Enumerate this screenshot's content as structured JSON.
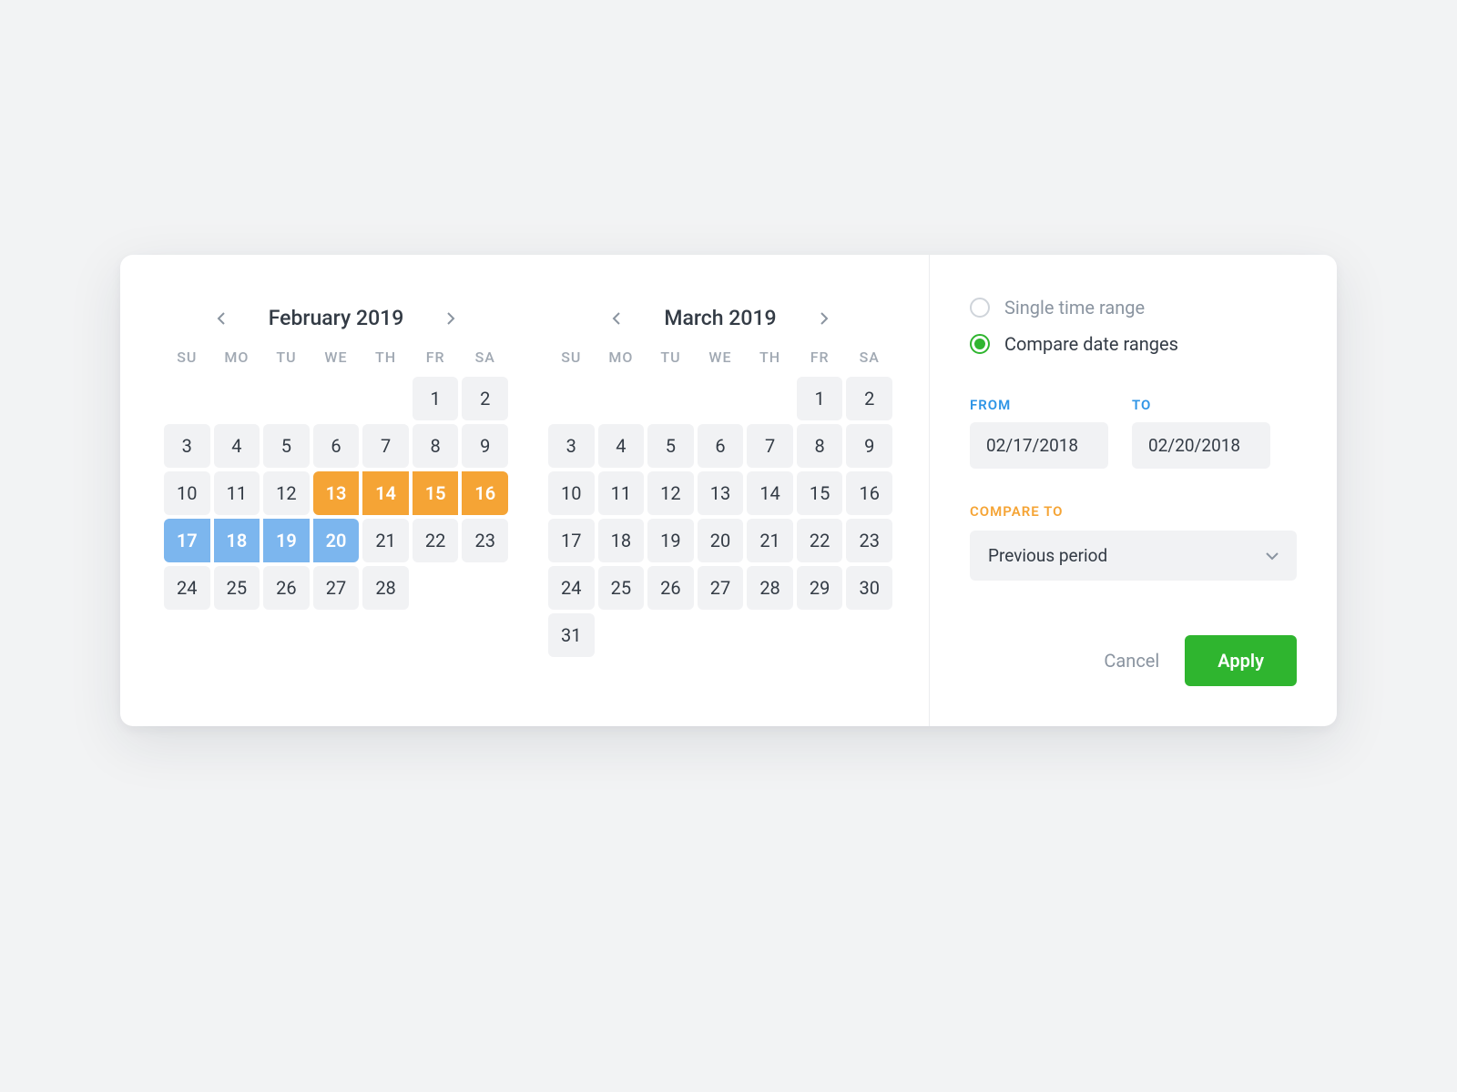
{
  "dow": [
    "SU",
    "MO",
    "TU",
    "WE",
    "TH",
    "FR",
    "SA"
  ],
  "calendars": [
    {
      "title": "February 2019",
      "leadingEmpty": 5,
      "days": 28,
      "orangeRange": [
        13,
        16
      ],
      "blueRange": [
        17,
        20
      ]
    },
    {
      "title": "March 2019",
      "leadingEmpty": 5,
      "days": 31,
      "orangeRange": null,
      "blueRange": null
    }
  ],
  "radios": {
    "single": "Single time range",
    "compare": "Compare date ranges",
    "selected": "compare"
  },
  "fields": {
    "from_label": "FROM",
    "from_value": "02/17/2018",
    "to_label": "TO",
    "to_value": "02/20/2018"
  },
  "compare": {
    "label": "COMPARE TO",
    "value": "Previous period"
  },
  "actions": {
    "cancel": "Cancel",
    "apply": "Apply"
  }
}
